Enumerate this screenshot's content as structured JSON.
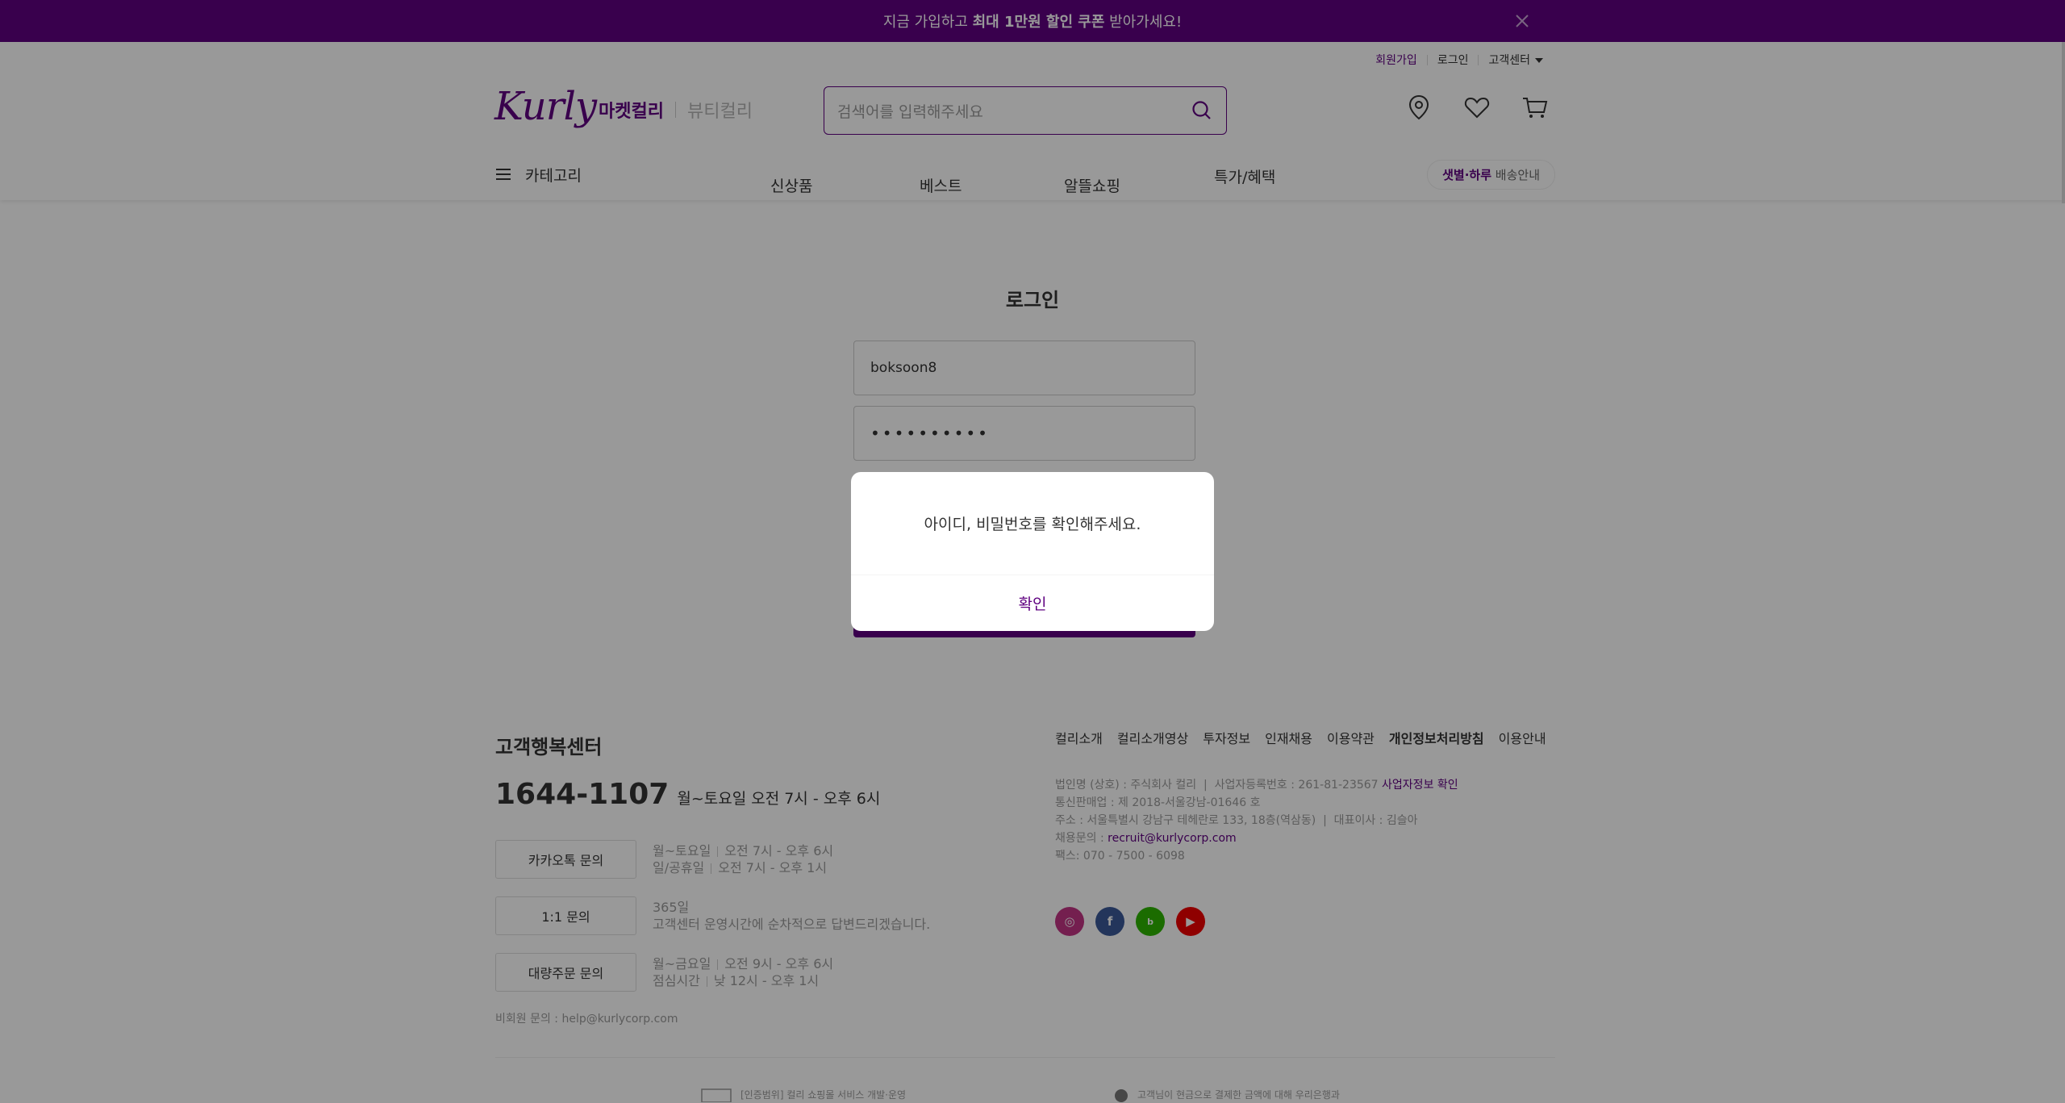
{
  "promo": {
    "text_before": "지금 가입하고 ",
    "text_bold": "최대 1만원 할인 쿠폰",
    "text_after": " 받아가세요!"
  },
  "util": {
    "signup": "회원가입",
    "login": "로그인",
    "support": "고객센터"
  },
  "header": {
    "logo": "Kurly",
    "service_active": "마켓컬리",
    "service_inactive": "뷰티컬리",
    "search_placeholder": "검색어를 입력해주세요",
    "category": "카테고리",
    "menu": [
      "신상품",
      "베스트",
      "알뜰쇼핑",
      "특가/혜택"
    ],
    "ship_bold": "샛별·하루",
    "ship_text": " 배송안내"
  },
  "login": {
    "title": "로그인",
    "id_value": "boksoon8",
    "pw_value": "••••••••••"
  },
  "modal": {
    "message": "아이디, 비밀번호를 확인해주세요.",
    "confirm": "확인"
  },
  "footer": {
    "cs_title": "고객행복센터",
    "phone": "1644-1107",
    "phone_hours": "월~토요일 오전 7시 - 오후 6시",
    "kakao": {
      "label": "카카오톡 문의",
      "l1a": "월~토요일",
      "l1b": "오전 7시 - 오후 6시",
      "l2a": "일/공휴일",
      "l2b": "오전 7시 - 오후 1시"
    },
    "one": {
      "label": "1:1 문의",
      "l1": "365일",
      "l2": "고객센터 운영시간에 순차적으로 답변드리겠습니다."
    },
    "bulk": {
      "label": "대량주문 문의",
      "l1a": "월~금요일",
      "l1b": "오전 9시 - 오후 6시",
      "l2a": "점심시간",
      "l2b": "낮 12시 - 오후 1시"
    },
    "guest": "비회원 문의 : help@kurlycorp.com",
    "links": [
      "컬리소개",
      "컬리소개영상",
      "투자정보",
      "인재채용",
      "이용약관",
      "개인정보처리방침",
      "이용안내"
    ],
    "info1": "법인명 (상호) : 주식회사 컬리  |  사업자등록번호 : 261-81-23567 ",
    "info1_link": "사업자정보 확인",
    "info2": "통신판매업 : 제 2018-서울강남-01646 호",
    "info3": "주소 : 서울특별시 강남구 테헤란로 133, 18층(역삼동)  |  대표이사 : 김슬아",
    "info4": "채용문의 : ",
    "info4_link": "recruit@kurlycorp.com",
    "info5": "팩스: 070 - 7500 - 6098",
    "cert1": "[인증범위] 컬리 쇼핑몰 서비스 개발·운영",
    "cert2": "고객님이 현금으로 결제한 금액에 대해 우리은행과"
  }
}
